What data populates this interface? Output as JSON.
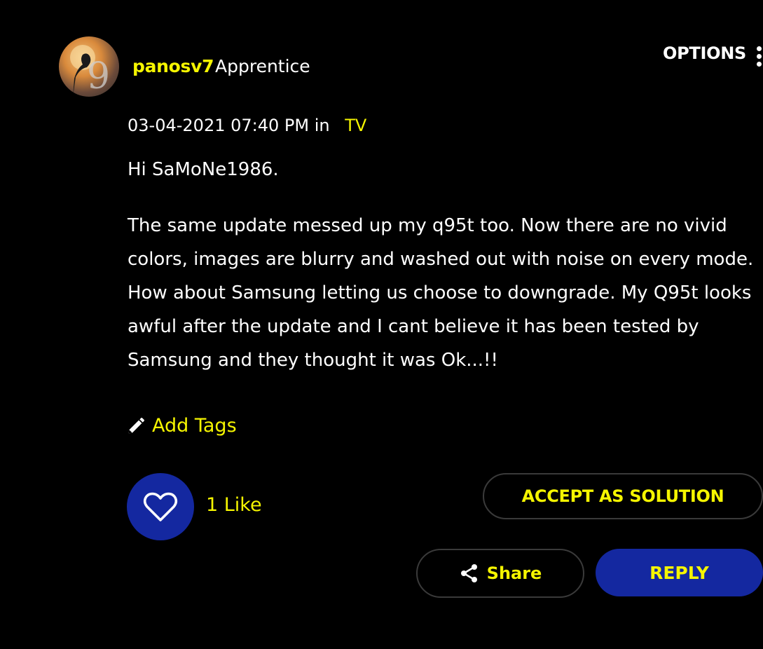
{
  "post": {
    "author": {
      "username": "panosv7",
      "rank": "Apprentice"
    },
    "options_label": "OPTIONS",
    "date": "03-04-2021 07:40 PM",
    "in_label": "in",
    "board": "TV",
    "greeting": "Hi SaMoNe1986.",
    "body": "The same update messed up my q95t too. Now there are no vivid colors, images are blurry and washed out with noise on every mode.  How about Samsung letting us choose to downgrade. My Q95t looks awful after the update and I cant believe it has been tested by Samsung and they thought it was Ok...!!",
    "add_tags_label": "Add Tags",
    "like_count": "1 Like",
    "accept_label": "ACCEPT AS SOLUTION",
    "share_label": "Share",
    "reply_label": "REPLY"
  },
  "colors": {
    "background": "#000000",
    "accent_yellow": "#f5f500",
    "brand_blue": "#1428a0",
    "text": "#ffffff"
  },
  "icons": {
    "edit": "pencil-icon",
    "like": "heart-icon",
    "share": "share-icon",
    "menu": "kebab-menu-icon"
  }
}
